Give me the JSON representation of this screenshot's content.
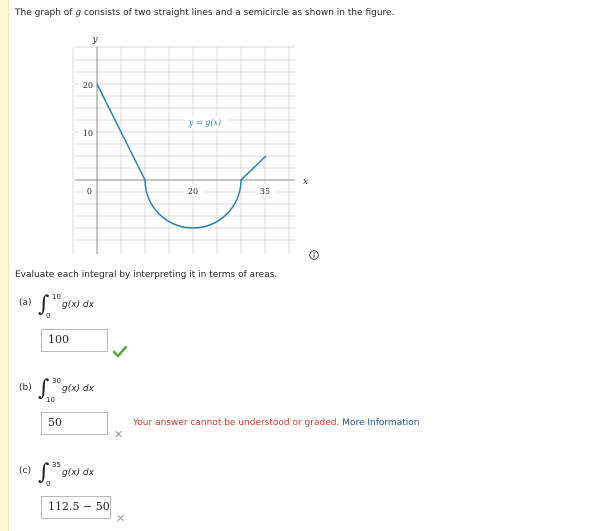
{
  "intro": {
    "text_before": "The graph of ",
    "var": "g",
    "text_after": " consists of two straight lines and a semicircle as shown in the figure."
  },
  "graph": {
    "y_axis_label": "y",
    "x_axis_label": "x",
    "y_ticks": [
      "20",
      "10",
      "0"
    ],
    "x_ticks": [
      "20",
      "35"
    ],
    "curve_label": "y = g(x)",
    "curve_color": "#2a7fb5"
  },
  "evaluate_text": "Evaluate each integral by interpreting it in terms of areas.",
  "parts": [
    {
      "label": "(a)",
      "upper": "10",
      "lower": "0",
      "integrand": "g(x) dx",
      "answer": "100",
      "status": "correct"
    },
    {
      "label": "(b)",
      "upper": "30",
      "lower": "10",
      "integrand": "g(x) dx",
      "answer": "50",
      "status": "incorrect"
    },
    {
      "label": "(c)",
      "upper": "35",
      "lower": "0",
      "integrand": "g(x) dx",
      "answer": "112.5 − 50",
      "status": "incorrect"
    }
  ],
  "feedback": {
    "error": "Your answer cannot be understood or graded.",
    "link": "More Information"
  },
  "colors": {
    "correct": "#5aa845",
    "error": "#c0392b",
    "link": "#1a4d8c"
  }
}
